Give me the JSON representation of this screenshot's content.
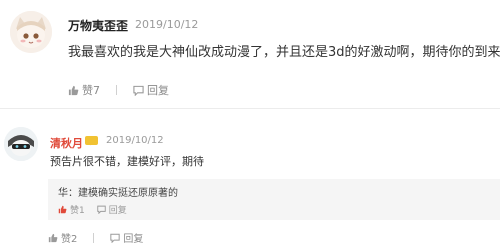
{
  "comments": [
    {
      "username": "万物夷歪歪",
      "date": "2019/10/12",
      "content": "我最喜欢的我是大神仙改成动漫了，并且还是3d的好激动啊，期待你的到来",
      "like_label": "赞7",
      "reply_label": "回复"
    },
    {
      "username": "清秋月丶",
      "date": "2019/10/12",
      "content": "预告片很不错，建模好评，期待",
      "like_label": "赞2",
      "reply_label": "回复",
      "reply": {
        "text": "华：建模确实挺还原原著的",
        "like_label": "赞1",
        "reply_label": "回复"
      }
    }
  ],
  "colors": {
    "username2": "#e04a3a",
    "badge": "#f1c232",
    "reply_bg": "#f5f5f5"
  }
}
